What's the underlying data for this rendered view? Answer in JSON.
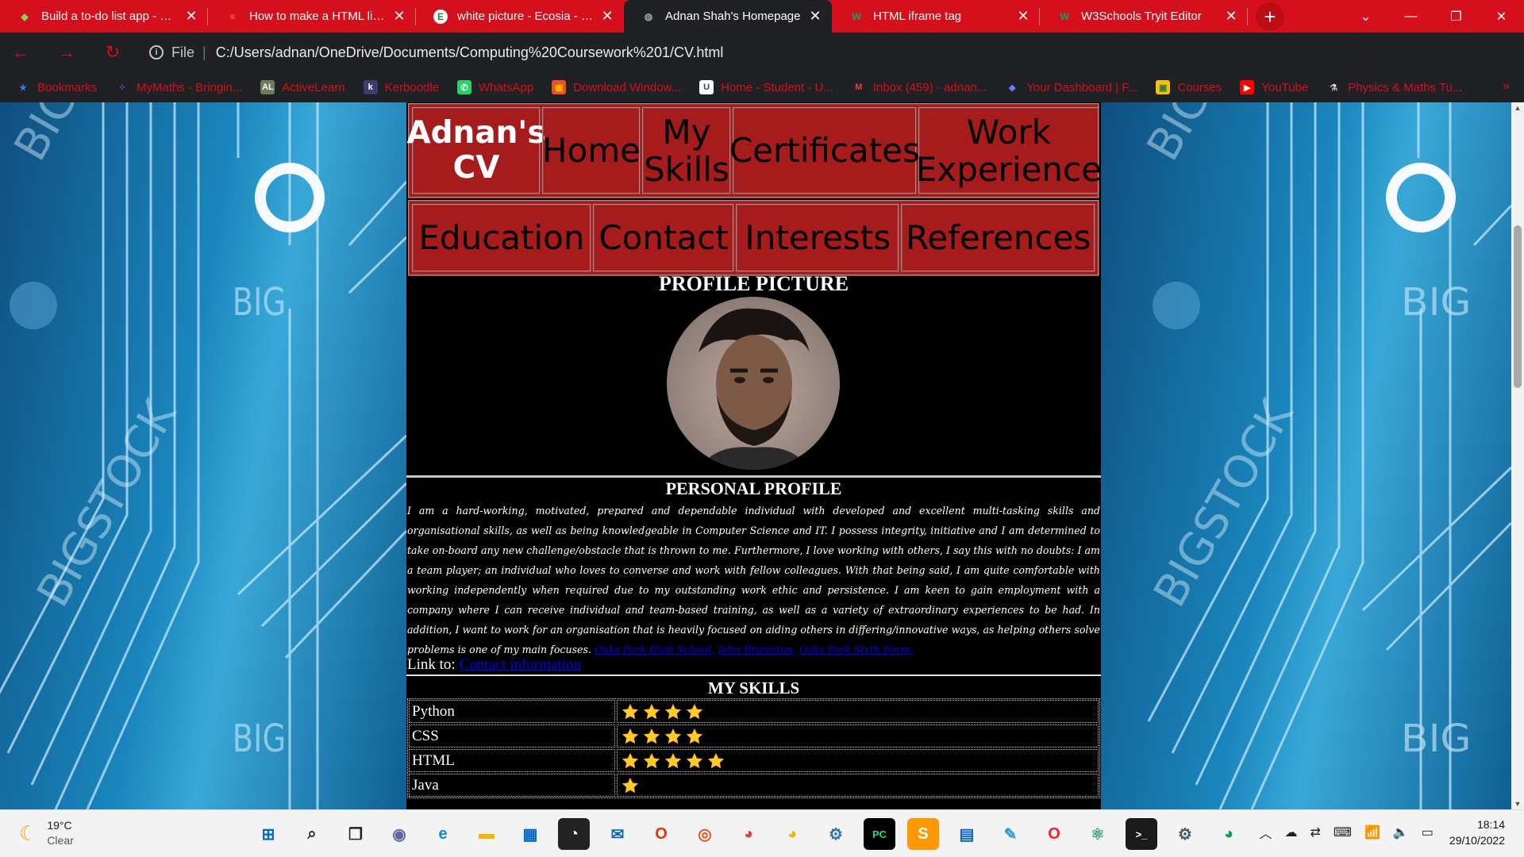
{
  "tabs": [
    {
      "title": "Build a to-do list app - Get",
      "icon": "gem-icon",
      "color": "#7ed957"
    },
    {
      "title": "How to make a HTML list a",
      "icon": "stack-overflow-icon",
      "color": "#f48024"
    },
    {
      "title": "white picture - Ecosia - Ima",
      "icon": "ecosia-icon",
      "color": "#ffffff"
    },
    {
      "title": "Adnan Shah's Homepage",
      "icon": "globe-icon",
      "color": "#9aa0a6"
    },
    {
      "title": "HTML iframe tag",
      "icon": "w3schools-icon",
      "color": "#04aa6d"
    },
    {
      "title": "W3Schools Tryit Editor",
      "icon": "w3schools-icon",
      "color": "#04aa6d"
    }
  ],
  "address": {
    "scheme_label": "File",
    "url": "C:/Users/adnan/OneDrive/Documents/Computing%20Coursework%201/CV.html"
  },
  "bookmarks": [
    {
      "label": "Bookmarks",
      "icon": "star-icon",
      "glyph": "★",
      "bg": "transparent",
      "fg": "#2f7de1"
    },
    {
      "label": "MyMaths - Bringin...",
      "icon": "mymaths-icon",
      "glyph": "⁘",
      "bg": "transparent",
      "fg": "#7a5cff"
    },
    {
      "label": "ActiveLearn",
      "icon": "activelearn-icon",
      "glyph": "AL",
      "bg": "#6b7d5a",
      "fg": "#ffffff"
    },
    {
      "label": "Kerboodle",
      "icon": "kerboodle-icon",
      "glyph": "k",
      "bg": "#3c3c6e",
      "fg": "#ffffff"
    },
    {
      "label": "WhatsApp",
      "icon": "whatsapp-icon",
      "glyph": "✆",
      "bg": "#25d366",
      "fg": "#ffffff"
    },
    {
      "label": "Download Window...",
      "icon": "windows-icon",
      "glyph": "▦",
      "bg": "#f25022",
      "fg": "#ffb900"
    },
    {
      "label": "Home - Student - U...",
      "icon": "student-portal-icon",
      "glyph": "U",
      "bg": "#ffffff",
      "fg": "#1a4b8c"
    },
    {
      "label": "Inbox (459) - adnan...",
      "icon": "gmail-icon",
      "glyph": "M",
      "bg": "transparent",
      "fg": "#ea4335"
    },
    {
      "label": "Your Dashboard | F...",
      "icon": "dashboard-icon",
      "glyph": "◆",
      "bg": "transparent",
      "fg": "#6c7bff"
    },
    {
      "label": "Courses",
      "icon": "courses-icon",
      "glyph": "▣",
      "bg": "#f4c20d",
      "fg": "#2e7d32"
    },
    {
      "label": "YouTube",
      "icon": "youtube-icon",
      "glyph": "▶",
      "bg": "#ff0000",
      "fg": "#ffffff"
    },
    {
      "label": "Physics & Maths Tu...",
      "icon": "physics-maths-icon",
      "glyph": "⚗",
      "bg": "transparent",
      "fg": "#cfcfcf"
    }
  ],
  "bookmarks_more": "»",
  "cv": {
    "nav_row1": [
      {
        "label": "Adnan's CV",
        "brand": true
      },
      {
        "label": "Home"
      },
      {
        "label": "My Skills"
      },
      {
        "label": "Certificates"
      },
      {
        "label": "Work Experience"
      }
    ],
    "nav_row2": [
      {
        "label": "Education"
      },
      {
        "label": "Contact"
      },
      {
        "label": "Interests"
      },
      {
        "label": "References"
      }
    ],
    "profile_picture_title": "PROFILE PICTURE",
    "personal_profile_title": "PERSONAL PROFILE",
    "bio": "I am a hard-working, motivated, prepared and dependable individual with developed and excellent multi-tasking skills and organisational skills, as well as being knowledgeable in Computer Science and IT. I possess integrity, initiative and I am determined to take on-board any new challenge/obstacle that is thrown to me. Furthermore, I love working with others, I say this with no doubts: I am a team player; an individual who loves to converse and work with fellow colleagues. With that being said, I am quite comfortable with working independently when required due to my outstanding work ethic and persistence. I am keen to gain employment with a company where I can receive individual and team-based training, as well as a variety of extraordinary experiences to be had. In addition, I want to work for an organisation that is heavily focused on aiding others in differing/innovative ways, as helping others solve problems is one of my main focuses.",
    "bio_links": [
      "Oaks Park High School,",
      "John Bramston,",
      "Oaks Park Sixth Form,"
    ],
    "link_to_label": "Link to:",
    "link_to_text": "Contact information",
    "skills_title": "MY SKILLS",
    "skills": [
      {
        "name": "Python",
        "stars": 4
      },
      {
        "name": "CSS",
        "stars": 4
      },
      {
        "name": "HTML",
        "stars": 5
      },
      {
        "name": "Java",
        "stars": 1
      }
    ]
  },
  "taskbar": {
    "weather_temp": "19°C",
    "weather_desc": "Clear",
    "time": "18:14",
    "date": "29/10/2022",
    "apps": [
      {
        "name": "start-icon",
        "glyph": "⊞",
        "fg": "#0067c0",
        "bg": "transparent"
      },
      {
        "name": "search-icon",
        "glyph": "⌕",
        "fg": "#222222",
        "bg": "transparent"
      },
      {
        "name": "task-view-icon",
        "glyph": "❐",
        "fg": "#222222",
        "bg": "transparent"
      },
      {
        "name": "teams-chat-icon",
        "glyph": "◉",
        "fg": "#6264a7",
        "bg": "transparent"
      },
      {
        "name": "edge-icon",
        "glyph": "e",
        "fg": "#0c8ad6",
        "bg": "transparent"
      },
      {
        "name": "file-explorer-icon",
        "glyph": "▬",
        "fg": "#f4b400",
        "bg": "transparent"
      },
      {
        "name": "store-icon",
        "glyph": "▦",
        "fg": "#0067c0",
        "bg": "transparent"
      },
      {
        "name": "speedometer-icon",
        "glyph": "◔",
        "fg": "#ffffff",
        "bg": "#222222"
      },
      {
        "name": "mail-icon",
        "glyph": "✉",
        "fg": "#0a64c2",
        "bg": "transparent"
      },
      {
        "name": "office-icon",
        "glyph": "O",
        "fg": "#d83b01",
        "bg": "transparent"
      },
      {
        "name": "ubuntu-icon",
        "glyph": "◎",
        "fg": "#e95420",
        "bg": "transparent"
      },
      {
        "name": "chrome-icon",
        "glyph": "◕",
        "fg": "#db4437",
        "bg": "transparent"
      },
      {
        "name": "chrome-canary-icon",
        "glyph": "◕",
        "fg": "#f4b400",
        "bg": "transparent"
      },
      {
        "name": "python-idle-icon",
        "glyph": "⚙",
        "fg": "#3776ab",
        "bg": "transparent"
      },
      {
        "name": "pycharm-icon",
        "glyph": "PC",
        "fg": "#21d789",
        "bg": "#000000"
      },
      {
        "name": "sublime-icon",
        "glyph": "S",
        "fg": "#ffffff",
        "bg": "#ff9800"
      },
      {
        "name": "notepad-icon",
        "glyph": "▤",
        "fg": "#0a64c2",
        "bg": "transparent"
      },
      {
        "name": "tools-icon",
        "glyph": "✎",
        "fg": "#2e9bd6",
        "bg": "transparent"
      },
      {
        "name": "opera-icon",
        "glyph": "O",
        "fg": "#ff1b2d",
        "bg": "transparent"
      },
      {
        "name": "atom-icon",
        "glyph": "⚛",
        "fg": "#40a977",
        "bg": "transparent"
      },
      {
        "name": "terminal-icon",
        "glyph": ">_",
        "fg": "#ffffff",
        "bg": "#1a1a1a"
      },
      {
        "name": "settings-icon",
        "glyph": "⚙",
        "fg": "#4a5a6a",
        "bg": "transparent"
      },
      {
        "name": "chrome-profile-icon",
        "glyph": "◕",
        "fg": "#0f9d58",
        "bg": "transparent"
      }
    ]
  }
}
